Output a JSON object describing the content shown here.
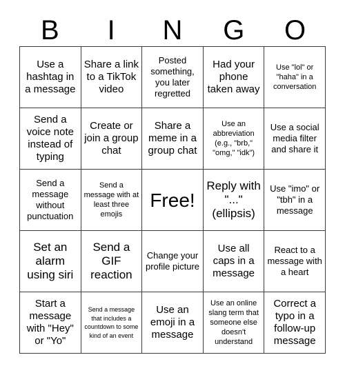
{
  "card": {
    "title": "BINGO",
    "header_letters": [
      "B",
      "I",
      "N",
      "G",
      "O"
    ],
    "grid_size": "5x5",
    "free_space_index": 12,
    "colors": {
      "background": "#ffffff",
      "text": "#000000",
      "border": "#3a3a3a"
    }
  },
  "cells": [
    {
      "text": "Use a hashtag in a message",
      "size": "md"
    },
    {
      "text": "Share a link to a TikTok video",
      "size": "md"
    },
    {
      "text": "Posted something, you later regretted",
      "size": "sm"
    },
    {
      "text": "Had your phone taken away",
      "size": "md"
    },
    {
      "text": "Use \"lol\" or \"haha\" in a conversation",
      "size": "xs"
    },
    {
      "text": "Send a voice note instead of typing",
      "size": "md"
    },
    {
      "text": "Create or join a group chat",
      "size": "md"
    },
    {
      "text": "Share a meme in a group chat",
      "size": "md"
    },
    {
      "text": "Use an abbreviation (e.g., \"brb,\" \"omg,\" \"idk\")",
      "size": "xs"
    },
    {
      "text": "Use a social media filter and share it",
      "size": "sm"
    },
    {
      "text": "Send a message without punctuation",
      "size": "sm"
    },
    {
      "text": "Send a message with at least three emojis",
      "size": "xs"
    },
    {
      "text": "Free!",
      "size": "xl"
    },
    {
      "text": "Reply with \"...\" (ellipsis)",
      "size": "lg"
    },
    {
      "text": "Use \"imo\" or \"tbh\" in a message",
      "size": "sm"
    },
    {
      "text": "Set an alarm using siri",
      "size": "lg"
    },
    {
      "text": "Send a GIF reaction",
      "size": "lg"
    },
    {
      "text": "Change your profile picture",
      "size": "sm"
    },
    {
      "text": "Use all caps in a message",
      "size": "md"
    },
    {
      "text": "React to a message with a heart",
      "size": "sm"
    },
    {
      "text": "Start a message with \"Hey\" or \"Yo\"",
      "size": "md"
    },
    {
      "text": "Send a message that includes a countdown to some kind of an event",
      "size": "xxs"
    },
    {
      "text": "Use an emoji in a message",
      "size": "md"
    },
    {
      "text": "Use an online slang term that someone else doesn't understand",
      "size": "xs"
    },
    {
      "text": "Correct a typo in a follow-up message",
      "size": "md"
    }
  ]
}
